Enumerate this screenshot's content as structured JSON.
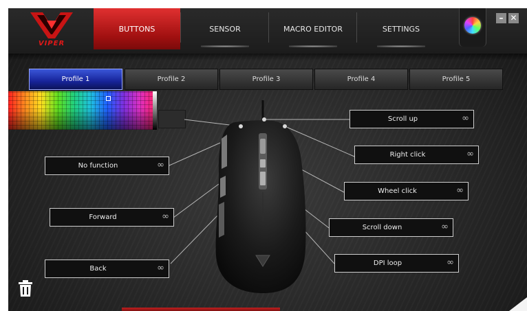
{
  "brand": {
    "logo_text": "VIPER",
    "accent_color": "#d81c1c"
  },
  "nav": {
    "tabs": [
      {
        "label": "BUTTONS",
        "active": true
      },
      {
        "label": "SENSOR",
        "active": false
      },
      {
        "label": "MACRO EDITOR",
        "active": false
      },
      {
        "label": "SETTINGS",
        "active": false
      }
    ]
  },
  "window_controls": {
    "minimize": "–",
    "close": "✕"
  },
  "profiles": [
    {
      "label": "Profile 1",
      "active": true
    },
    {
      "label": "Profile 2",
      "active": false
    },
    {
      "label": "Profile 3",
      "active": false
    },
    {
      "label": "Profile 4",
      "active": false
    },
    {
      "label": "Profile 5",
      "active": false
    }
  ],
  "buttons": {
    "scroll_up": {
      "label": "Scroll up",
      "icon": "∞"
    },
    "right_click": {
      "label": "Right click",
      "icon": "∞"
    },
    "wheel_click": {
      "label": "Wheel click",
      "icon": "∞"
    },
    "scroll_down": {
      "label": "Scroll down",
      "icon": "∞"
    },
    "dpi_loop": {
      "label": "DPI loop",
      "icon": "∞"
    },
    "left_top": {
      "label": "No function",
      "icon": "∞"
    },
    "forward": {
      "label": "Forward",
      "icon": "∞"
    },
    "back": {
      "label": "Back",
      "icon": "∞"
    }
  },
  "icons": {
    "color_wheel": "color-wheel-icon",
    "trash": "trash-icon",
    "link": "infinity-icon"
  }
}
